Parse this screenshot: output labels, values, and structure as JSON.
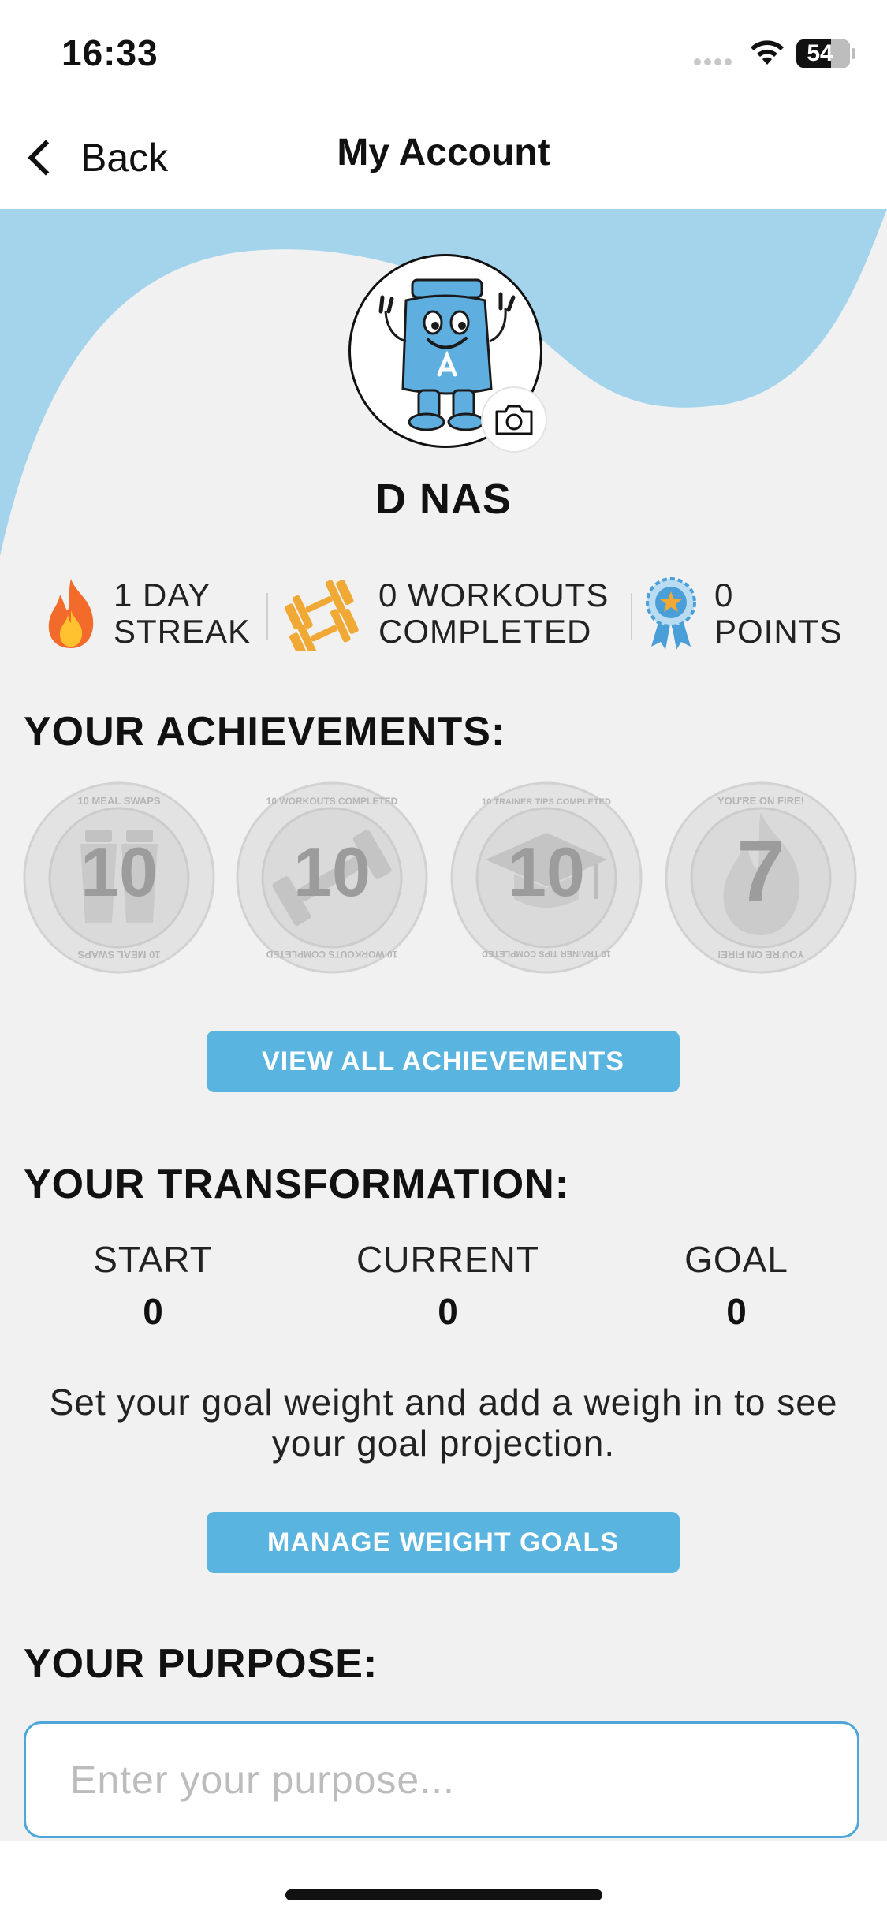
{
  "status": {
    "time": "16:33",
    "battery": "54"
  },
  "nav": {
    "back_label": "Back",
    "title": "My Account"
  },
  "profile": {
    "name": "D NAS"
  },
  "stats": {
    "streak": {
      "line1": "1 DAY",
      "line2": "STREAK",
      "icon": "flame-icon"
    },
    "workouts": {
      "line1": "0 WORKOUTS",
      "line2": "COMPLETED",
      "icon": "dumbbell-icon"
    },
    "points": {
      "line1": "0",
      "line2": "POINTS",
      "icon": "ribbon-award-icon"
    }
  },
  "achievements": {
    "heading": "YOUR ACHIEVEMENTS:",
    "badges": [
      {
        "number": "10",
        "ring_text": "10 MEAL SWAPS",
        "icon": "shaker-icon"
      },
      {
        "number": "10",
        "ring_text": "10 WORKOUTS COMPLETED",
        "icon": "dumbbell-icon"
      },
      {
        "number": "10",
        "ring_text": "10 TRAINER TIPS COMPLETED",
        "icon": "graduation-cap-icon"
      },
      {
        "number": "7",
        "ring_text": "YOU'RE ON FIRE!",
        "icon": "flame-icon"
      }
    ],
    "button_label": "VIEW ALL ACHIEVEMENTS"
  },
  "transformation": {
    "heading": "YOUR TRANSFORMATION:",
    "columns": [
      {
        "label": "START",
        "value": "0"
      },
      {
        "label": "CURRENT",
        "value": "0"
      },
      {
        "label": "GOAL",
        "value": "0"
      }
    ],
    "hint": "Set your goal weight and add a weigh in to see your goal projection.",
    "button_label": "MANAGE WEIGHT GOALS"
  },
  "purpose": {
    "heading": "YOUR PURPOSE:",
    "placeholder": "Enter your purpose..."
  },
  "colors": {
    "accent": "#5ab4e0",
    "wave": "#a3d4ec",
    "background": "#f1f1f1",
    "flame": "#f26b2a",
    "dumbbell": "#f0a935",
    "ribbon": "#4a9fd8"
  }
}
